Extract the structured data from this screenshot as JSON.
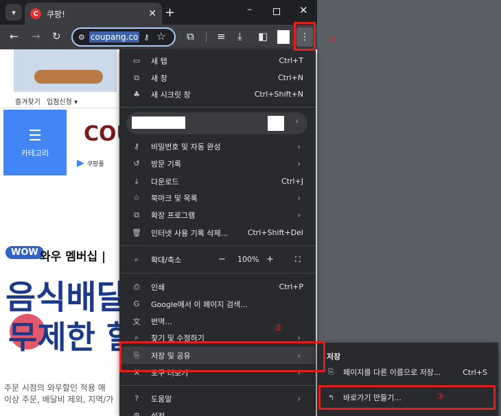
{
  "tab": {
    "title": "쿠팡!",
    "favicon_letter": "C",
    "close": "✕"
  },
  "window": {
    "new_tab": "+",
    "minimize": "–",
    "close": "✕"
  },
  "omnibox": {
    "url": "coupang.co"
  },
  "page": {
    "subnav": [
      "즐겨찾기",
      "입점신청 ▾"
    ],
    "category_label": "카테고리",
    "logo": "COU",
    "play_chip": "쿠팡플",
    "wow_badge": "WOW",
    "wow_text": "와우 멤버십 | ",
    "hero_line1": "음식배달",
    "hero_line2": "무제한 할",
    "footer_line1": "주문 시점의 와우할인 적용 매",
    "footer_line2": "이상 주문, 배달비 제외, 지역/가"
  },
  "menu": {
    "new_tab": {
      "label": "새 탭",
      "shortcut": "Ctrl+T"
    },
    "new_window": {
      "label": "새 창",
      "shortcut": "Ctrl+N"
    },
    "incognito": {
      "label": "새 시크릿 창",
      "shortcut": "Ctrl+Shift+N"
    },
    "passwords": {
      "label": "비밀번호 및 자동 완성"
    },
    "history": {
      "label": "방문 기록"
    },
    "downloads": {
      "label": "다운로드",
      "shortcut": "Ctrl+J"
    },
    "bookmarks": {
      "label": "북마크 및 목록"
    },
    "extensions": {
      "label": "확장 프로그램"
    },
    "clear_data": {
      "label": "인터넷 사용 기록 삭제...",
      "shortcut": "Ctrl+Shift+Del"
    },
    "zoom": {
      "label": "확대/축소",
      "minus": "−",
      "value": "100%",
      "plus": "+"
    },
    "print": {
      "label": "인쇄",
      "shortcut": "Ctrl+P"
    },
    "google_search": {
      "label": "Google에서 이 페이지 검색..."
    },
    "translate": {
      "label": "번역..."
    },
    "find_edit": {
      "label": "찾기 및 수정하기"
    },
    "save_share": {
      "label": "저장 및 공유"
    },
    "more_tools": {
      "label": "도구 더보기"
    },
    "help": {
      "label": "도움말"
    },
    "settings": {
      "label": "설정"
    }
  },
  "submenu": {
    "title": "저장",
    "save_page": {
      "label": "페이지를 다른 이름으로 저장...",
      "shortcut": "Ctrl+S"
    },
    "create_shortcut": {
      "label": "바로가기 만들기..."
    }
  },
  "annotations": {
    "one": "①",
    "two": "②",
    "three": "③"
  },
  "colors": {
    "menu_bg": "#292a2d",
    "highlight": "#e0201c",
    "accent": "#4285f4"
  }
}
